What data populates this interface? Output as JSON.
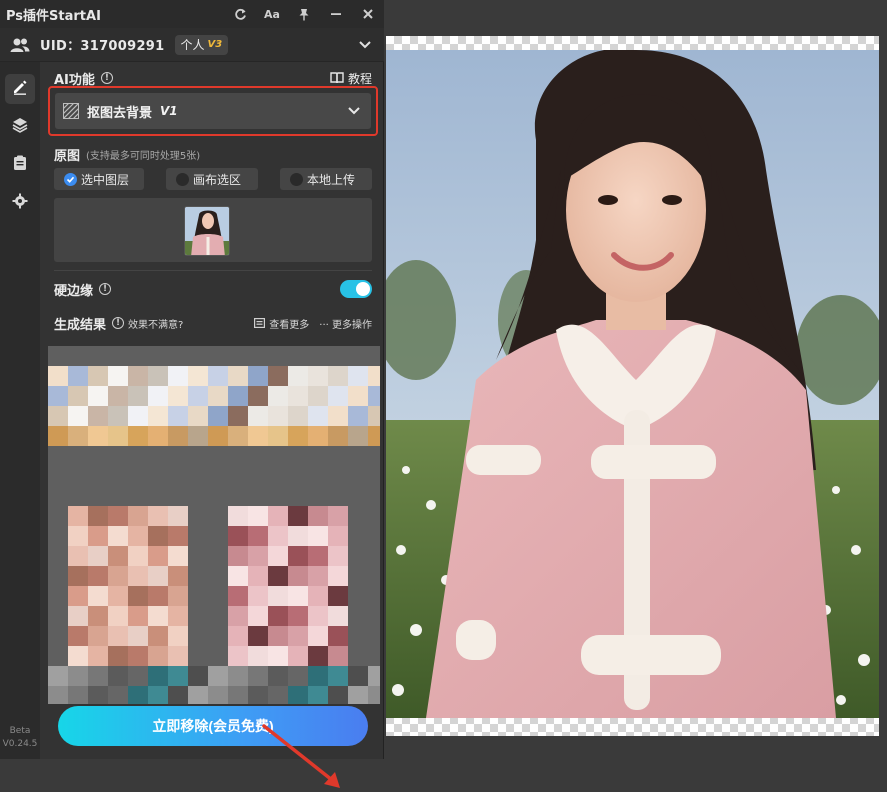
{
  "app": {
    "title": "Ps插件StartAI",
    "title_buttons": [
      "refresh-icon",
      "font-size-icon",
      "pin-icon",
      "minimize-icon",
      "close-icon"
    ],
    "font_button_label": "Aa"
  },
  "user": {
    "uid_text": "UID：317009291",
    "plan_label": "个人",
    "plan_level": "V3"
  },
  "sidebar": {
    "items": [
      "edit-icon",
      "layers-icon",
      "clipboard-icon",
      "settings-icon"
    ],
    "version_line1": "Beta",
    "version_line2": "V0.24.5"
  },
  "ai_function": {
    "label": "AI功能",
    "tutorial_label": "教程",
    "selected_function": "抠图去背景",
    "selected_version": "V1"
  },
  "source": {
    "label": "原图",
    "note": "(支持最多可同时处理5张)",
    "options": [
      {
        "label": "选中图层",
        "selected": true
      },
      {
        "label": "画布选区",
        "selected": false
      },
      {
        "label": "本地上传",
        "selected": false
      }
    ]
  },
  "hard_edge": {
    "label": "硬边缘",
    "enabled": true
  },
  "results": {
    "label": "生成结果",
    "unsatisfied_label": "效果不满意?",
    "view_more_label": "查看更多",
    "more_ops_label": "··· 更多操作"
  },
  "action": {
    "button_label": "立即移除(会员免费)"
  },
  "colors": {
    "accent_toggle": "#28c2e6",
    "highlight_border": "#e0392b",
    "button_gradient_start": "#17d6e8",
    "button_gradient_end": "#4a7df0",
    "annotation_arrow": "#e0392b"
  }
}
